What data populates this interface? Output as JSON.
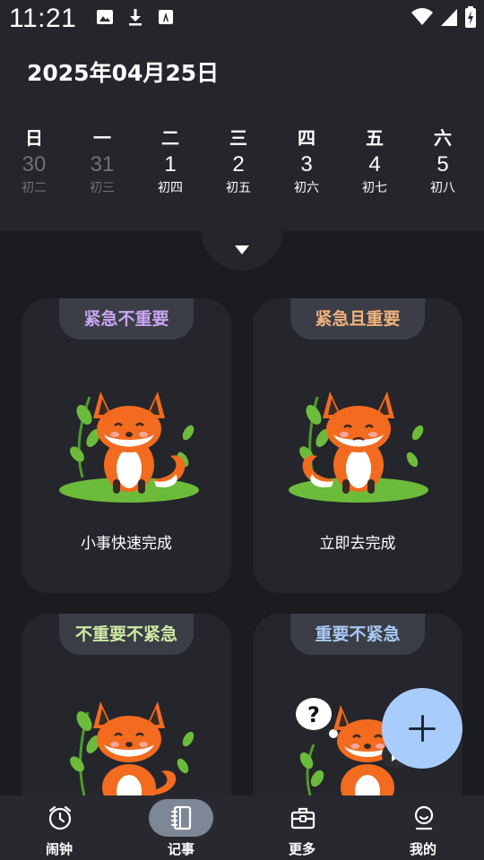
{
  "status_bar": {
    "time": "11:21",
    "icons_left": [
      "image-icon",
      "download-icon",
      "translate-icon"
    ],
    "icons_right": [
      "wifi-icon",
      "signal-icon",
      "battery-charging-icon"
    ]
  },
  "header": {
    "date_title": "2025年04月25日",
    "days": [
      {
        "weekday": "日",
        "day": "30",
        "lunar": "初二",
        "in_month": false
      },
      {
        "weekday": "一",
        "day": "31",
        "lunar": "初三",
        "in_month": false
      },
      {
        "weekday": "二",
        "day": "1",
        "lunar": "初四",
        "in_month": true
      },
      {
        "weekday": "三",
        "day": "2",
        "lunar": "初五",
        "in_month": true
      },
      {
        "weekday": "四",
        "day": "3",
        "lunar": "初六",
        "in_month": true
      },
      {
        "weekday": "五",
        "day": "4",
        "lunar": "初七",
        "in_month": true
      },
      {
        "weekday": "六",
        "day": "5",
        "lunar": "初八",
        "in_month": true
      }
    ]
  },
  "quadrants": [
    {
      "title": "紧急不重要",
      "title_color": "#c7a6f2",
      "caption": "小事快速完成",
      "fox": "fox-happy-illustration"
    },
    {
      "title": "紧急且重要",
      "title_color": "#f2b27e",
      "caption": "立即去完成",
      "fox": "fox-worried-illustration"
    },
    {
      "title": "不重要不紧急",
      "title_color": "#cfe9a4",
      "caption": "",
      "fox": "fox-relaxed-illustration"
    },
    {
      "title": "重要不紧急",
      "title_color": "#a9c9f5",
      "caption": "",
      "fox": "fox-thinking-illustration"
    }
  ],
  "fab": {
    "icon": "plus-icon",
    "color": "#a8cdfc"
  },
  "bottom_nav": {
    "items": [
      {
        "label": "闹钟",
        "icon": "alarm-clock-icon",
        "active": false
      },
      {
        "label": "记事",
        "icon": "notebook-icon",
        "active": true
      },
      {
        "label": "更多",
        "icon": "toolbox-icon",
        "active": false
      },
      {
        "label": "我的",
        "icon": "profile-icon",
        "active": false
      }
    ]
  },
  "colors": {
    "background": "#1b1c1f",
    "surface": "#24262c",
    "pill": "#3b3e46",
    "dim_text": "#6f7074",
    "nav_active": "#7e8796"
  }
}
